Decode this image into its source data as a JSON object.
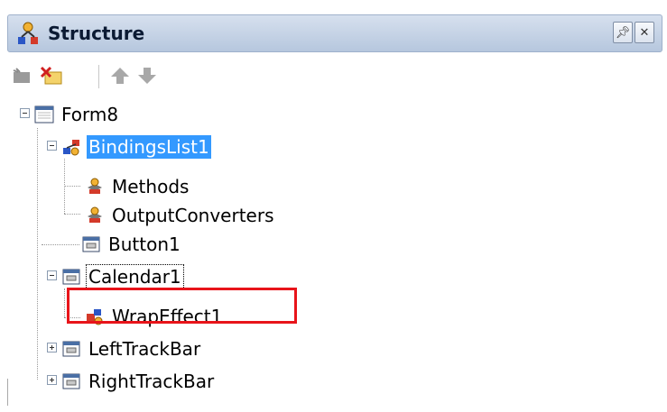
{
  "panel": {
    "title": "Structure"
  },
  "tree": {
    "items": [
      {
        "label": "Form8",
        "icon": "form-icon",
        "expanded": true
      },
      {
        "label": "BindingsList1",
        "icon": "bindingslist-icon",
        "expanded": true,
        "selected": true
      },
      {
        "label": "Methods",
        "icon": "category-icon"
      },
      {
        "label": "OutputConverters",
        "icon": "category-icon"
      },
      {
        "label": "Button1",
        "icon": "component-icon"
      },
      {
        "label": "Calendar1",
        "icon": "component-icon",
        "expanded": true,
        "focused": true
      },
      {
        "label": "WrapEffect1",
        "icon": "effect-icon",
        "highlighted": true
      },
      {
        "label": "LeftTrackBar",
        "icon": "component-icon",
        "expanded": false
      },
      {
        "label": "RightTrackBar",
        "icon": "component-icon",
        "expanded": false
      }
    ]
  },
  "colors": {
    "selection": "#3399ff",
    "highlight_border": "#e8141a",
    "titlebar": "#b6c7de"
  }
}
